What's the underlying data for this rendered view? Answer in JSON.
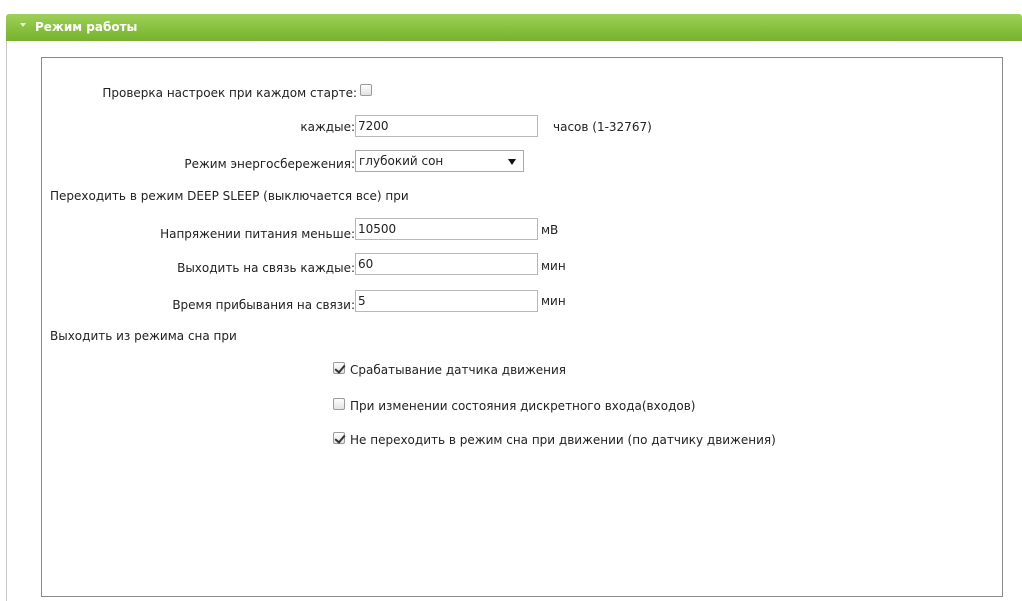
{
  "panel": {
    "title": "Режим работы"
  },
  "form": {
    "check_on_start_label": "Проверка настроек при каждом старте:",
    "check_on_start_checked": false,
    "every_label": "каждые:",
    "every_value": "7200",
    "every_suffix": "часов (1-32767)",
    "power_mode_label": "Режим энергосбережения:",
    "power_mode_value": "глубокий сон",
    "deep_sleep_heading": "Переходить в режим DEEP SLEEP (выключается все) при",
    "voltage_label": "Напряжении питания меньше:",
    "voltage_value": "10500",
    "voltage_unit": "мВ",
    "connect_every_label": "Выходить на связь каждые:",
    "connect_every_value": "60",
    "connect_every_unit": "мин",
    "stay_connected_label": "Время прибывания на связи:",
    "stay_connected_value": "5",
    "stay_connected_unit": "мин",
    "wake_heading": "Выходить из режима сна при",
    "wake_options": [
      {
        "label": "Срабатывание датчика движения",
        "checked": true
      },
      {
        "label": "При изменении состояния дискретного входа(входов)",
        "checked": false
      },
      {
        "label": "Не переходить в режим сна при движении (по датчику движения)",
        "checked": true
      }
    ]
  }
}
